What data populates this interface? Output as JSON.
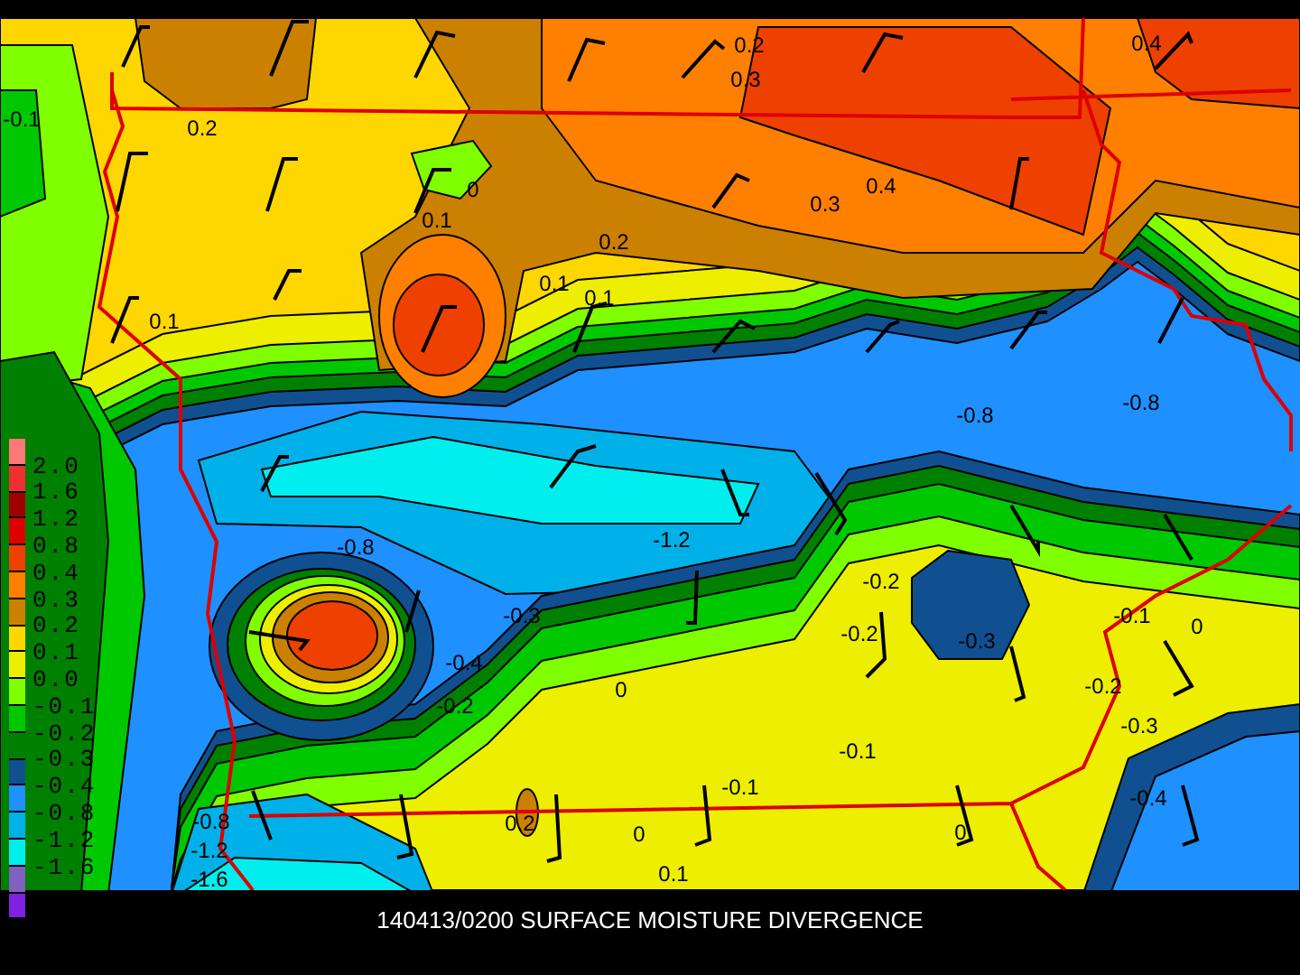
{
  "map": {
    "contour_labels": [
      "0.2",
      "0.3",
      "0.4",
      "-0.1",
      "0.2",
      "0",
      "0.1",
      "0.3",
      "0.4",
      "0.2",
      "0.1",
      "0.1",
      "0.1",
      "-0.8",
      "-0.8",
      "-0.8",
      "-1.2",
      "-0.2",
      "-0.3",
      "-0.2",
      "-0.3",
      "-0.1",
      "0",
      "-0.4",
      "0",
      "-0.2",
      "-0.3",
      "-0.2",
      "-0.1",
      "-0.4",
      "-0.8",
      "0.2",
      "-0.1",
      "0",
      "0",
      "-1.2",
      "-1.6",
      "0.1"
    ]
  },
  "legend": [
    {
      "color": "#ff7878"
    },
    {
      "label": "2.0",
      "color": "#ee3030"
    },
    {
      "label": "1.6",
      "color": "#a00000"
    },
    {
      "label": "1.2",
      "color": "#dd0000"
    },
    {
      "label": "0.8",
      "color": "#ee4000"
    },
    {
      "label": "0.4",
      "color": "#ff8000"
    },
    {
      "label": "0.3",
      "color": "#cc8000"
    },
    {
      "label": "0.2",
      "color": "#ffd700"
    },
    {
      "label": "0.1",
      "color": "#eeee00"
    },
    {
      "label": "0.0",
      "color": "#80ff00"
    },
    {
      "label": "-0.1",
      "color": "#00c800"
    },
    {
      "label": "-0.2",
      "color": "#008000"
    },
    {
      "label": "-0.3",
      "color": "#105090"
    },
    {
      "label": "-0.4",
      "color": "#1e90ff"
    },
    {
      "label": "-0.8",
      "color": "#00b0e8"
    },
    {
      "label": "-1.2",
      "color": "#00eeee"
    },
    {
      "label": "-1.6",
      "color": "#8060c0"
    },
    {
      "color": "#8020e0"
    }
  ],
  "title": "140413/0200 SURFACE MOISTURE DIVERGENCE"
}
